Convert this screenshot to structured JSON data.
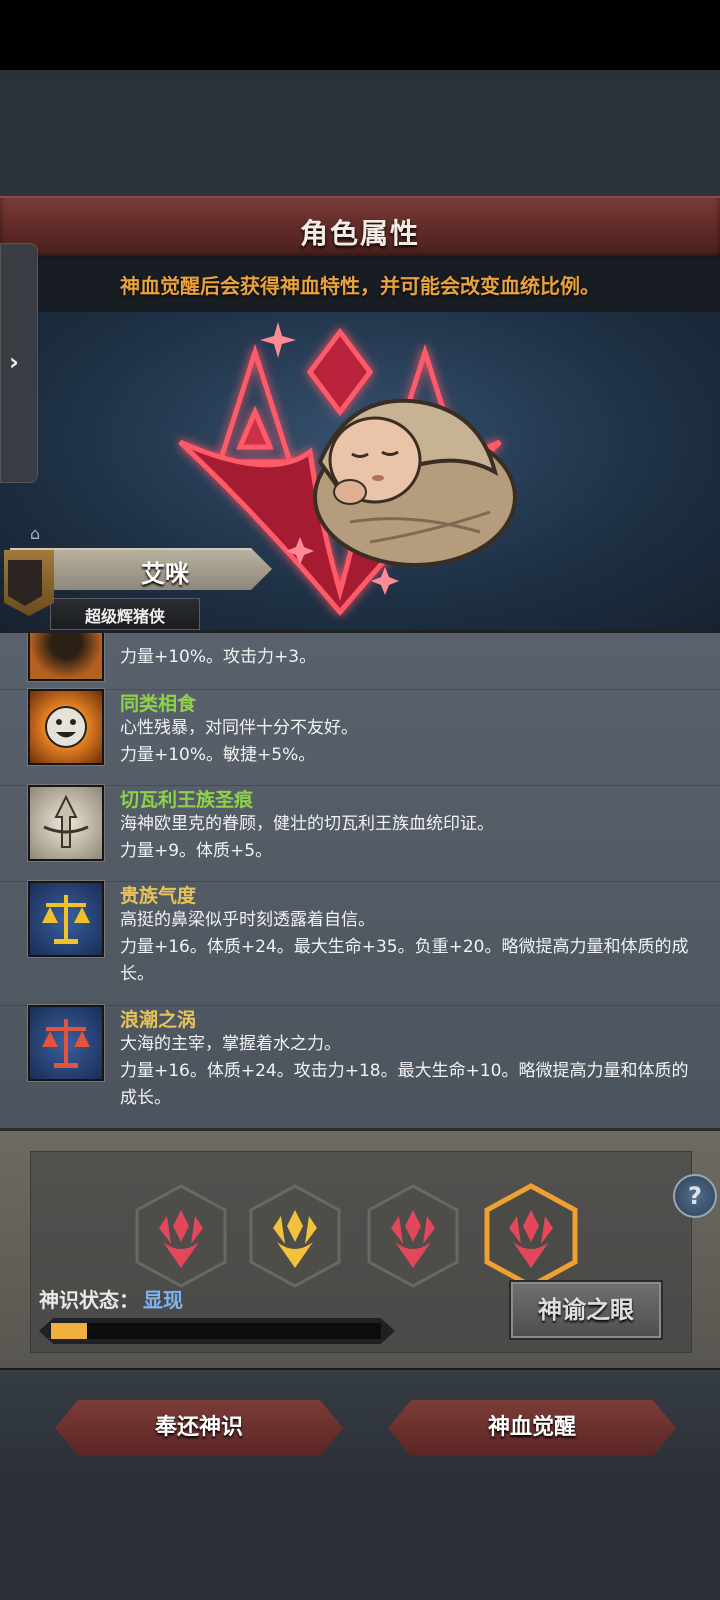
{
  "header": {
    "title": "角色属性",
    "subtitle": "神血觉醒后会获得神血特性，并可能会改变血统比例。"
  },
  "character": {
    "name": "艾咪",
    "class": "超级辉猪侠"
  },
  "traits": [
    {
      "name": "",
      "desc": "",
      "stats": "力量+10%。攻击力+3。",
      "icon": "sun-face-icon",
      "name_color": "#8fd24a"
    },
    {
      "name": "同类相食",
      "desc": "心性残暴，对同伴十分不友好。",
      "stats": "力量+10%。敏捷+5%。",
      "icon": "grin-face-icon",
      "name_color": "#8fd24a"
    },
    {
      "name": "切瓦利王族圣痕",
      "desc": "海神欧里克的眷顾，健壮的切瓦利王族血统印证。",
      "stats": "力量+9。体质+5。",
      "icon": "trident-crest-icon",
      "name_color": "#8fd24a"
    },
    {
      "name": "贵族气度",
      "desc": "高挺的鼻梁似乎时刻透露着自信。",
      "stats": "力量+16。体质+24。最大生命+35。负重+20。略微提高力量和体质的成长。",
      "icon": "gold-scales-icon",
      "name_color": "#e6c35a"
    },
    {
      "name": "浪潮之涡",
      "desc": "大海的主宰，掌握着水之力。",
      "stats": "力量+16。体质+24。攻击力+18。最大生命+10。略微提高力量和体质的成长。",
      "icon": "red-scales-icon",
      "name_color": "#e6c35a"
    }
  ],
  "divine": {
    "status_label": "神识状态：",
    "status_value": "显现",
    "progress": 0.11,
    "oracle_button": "神谕之眼",
    "slots": [
      {
        "icon": "crimson-sigil-icon",
        "selected": false
      },
      {
        "icon": "golden-sigil-icon",
        "selected": false
      },
      {
        "icon": "crimson-sigil-icon",
        "selected": false
      },
      {
        "icon": "crimson-sigil-icon",
        "selected": true
      }
    ]
  },
  "actions": {
    "return_button": "奉还神识",
    "awaken_button": "神血觉醒"
  },
  "colors": {
    "accent_red": "#7d3c38",
    "highlight_orange": "#f0a030",
    "trait_green": "#8fd24a",
    "trait_yellow": "#e6c35a"
  }
}
